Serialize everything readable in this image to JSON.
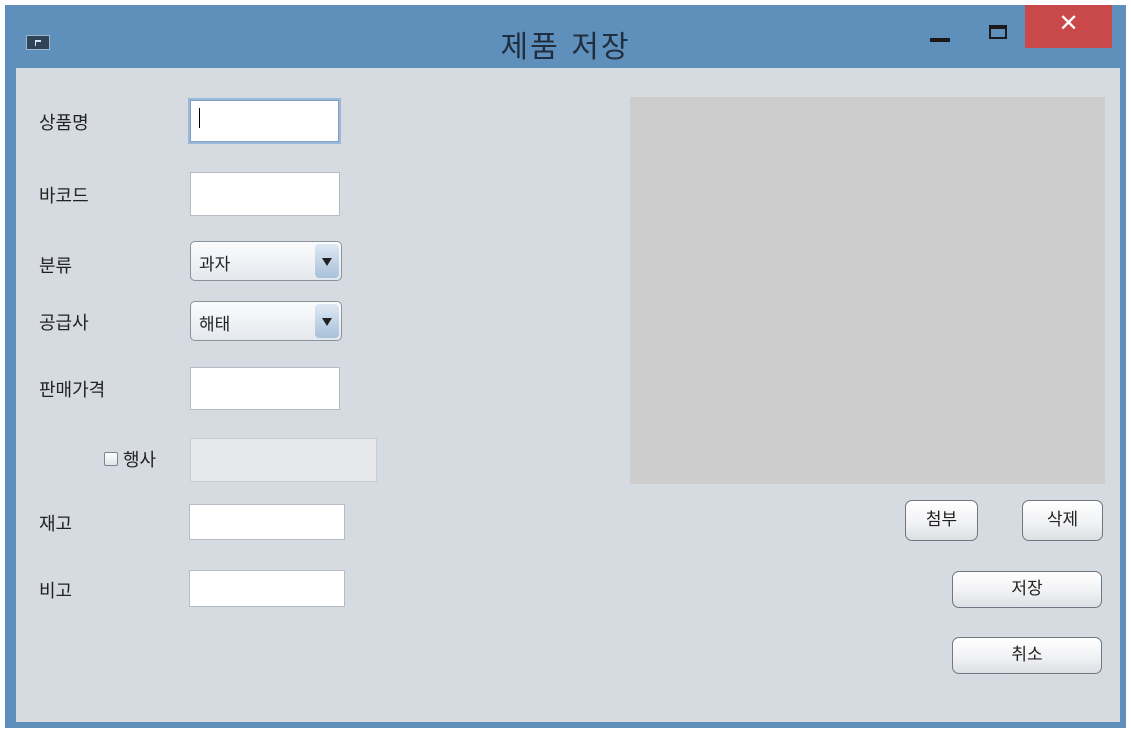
{
  "window": {
    "title": "제품 저장",
    "close_glyph": "✕"
  },
  "form": {
    "product_name_label": "상품명",
    "product_name_value": "",
    "barcode_label": "바코드",
    "barcode_value": "",
    "category_label": "분류",
    "category_selected": "과자",
    "supplier_label": "공급사",
    "supplier_selected": "해태",
    "price_label": "판매가격",
    "price_value": "",
    "event_label": "행사",
    "event_checked": false,
    "event_value": "",
    "stock_label": "재고",
    "stock_value": "",
    "note_label": "비고",
    "note_value": ""
  },
  "image_actions": {
    "attach_label": "첨부",
    "delete_label": "삭제"
  },
  "actions": {
    "save_label": "저장",
    "cancel_label": "취소"
  },
  "icons": {
    "app": "java-app-icon",
    "minimize": "minimize-icon",
    "maximize": "maximize-icon",
    "close": "close-icon",
    "dropdown": "chevron-down-icon"
  },
  "colors": {
    "titlebar": "#5f8fbb",
    "close_button": "#c9484a",
    "background": "#d6dae1",
    "image_panel": "#cdcdcd"
  }
}
